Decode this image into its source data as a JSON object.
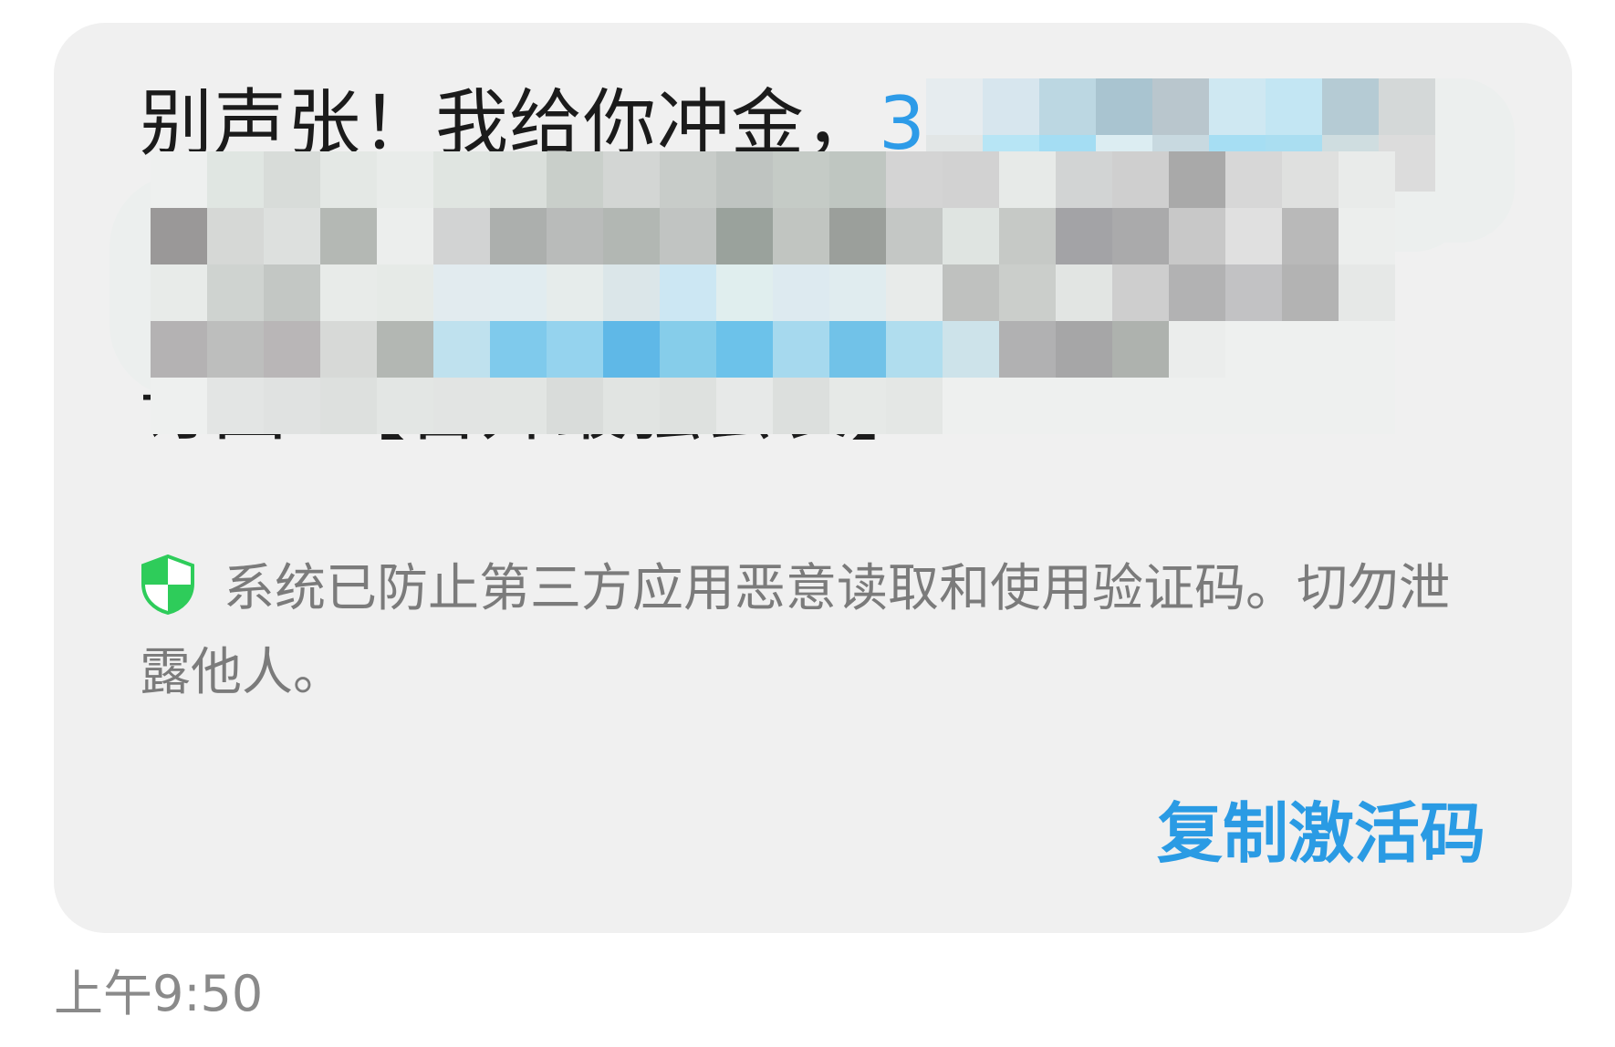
{
  "message": {
    "line1": "别声张！我给你冲金，",
    "line1_link": "3",
    "line3_tail": "起超",
    "line4": "订回T【晋升最强会长】"
  },
  "security_notice": {
    "icon": "shield-check-icon",
    "text": "系统已防止第三方应用恶意读取和使用验证码。切勿泄露他人。"
  },
  "actions": {
    "copy_label": "复制激活码"
  },
  "timestamp": "上午9:50",
  "colors": {
    "bubble": "#f0f0f0",
    "accent": "#2a9be4",
    "shield": "#2ecc5a"
  }
}
